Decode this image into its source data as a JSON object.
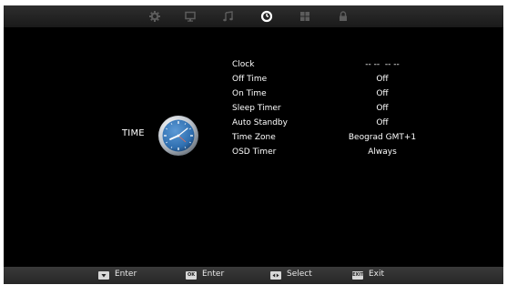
{
  "colors": {
    "screen_bg": "#000000",
    "text": "#ffffff",
    "active_tab": "#ffffff",
    "inactive_tab": "#5c5c5c",
    "clock_face": "#2f6fb0"
  },
  "tabs": [
    {
      "icon": "picture-gear-icon",
      "active": false
    },
    {
      "icon": "monitor-icon",
      "active": false
    },
    {
      "icon": "music-note-icon",
      "active": false
    },
    {
      "icon": "clock-icon",
      "active": true
    },
    {
      "icon": "grid-icon",
      "active": false
    },
    {
      "icon": "lock-icon",
      "active": false
    }
  ],
  "menu": {
    "title": "TIME",
    "icon": "clock-icon",
    "items": [
      {
        "label": "Clock",
        "value": "-- --  -- --"
      },
      {
        "label": "Off Time",
        "value": "Off"
      },
      {
        "label": "On Time",
        "value": "Off"
      },
      {
        "label": "Sleep Timer",
        "value": "Off"
      },
      {
        "label": "Auto Standby",
        "value": "Off"
      },
      {
        "label": "Time Zone",
        "value": "Beograd GMT+1"
      },
      {
        "label": "OSD Timer",
        "value": "Always"
      }
    ]
  },
  "footer": {
    "enter": {
      "key_icon": "down-arrow-key-icon",
      "label": "Enter"
    },
    "ok": {
      "key_text": "OK",
      "label": "Enter"
    },
    "select": {
      "key_icon": "left-right-key-icon",
      "label": "Select"
    },
    "exit": {
      "key_text": "EXIT",
      "label": "Exit"
    }
  }
}
